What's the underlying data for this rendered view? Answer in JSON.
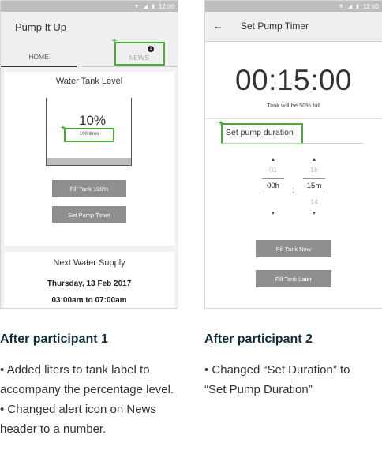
{
  "statusbar": {
    "time": "12:00",
    "wifi_icon": "wifi-icon",
    "signal_icon": "signal-icon",
    "battery_icon": "battery-icon"
  },
  "screen1": {
    "app_title": "Pump It Up",
    "tabs": [
      {
        "label": "HOME"
      },
      {
        "label": "NEWS"
      }
    ],
    "news_badge": "1",
    "tank_card": {
      "title": "Water Tank Level",
      "percent": "10%",
      "percent_value": 10,
      "litres": "100 litres",
      "buttons": [
        "Fill Tank 100%",
        "Set Pump Timer"
      ]
    },
    "supply_card": {
      "title": "Next Water Supply",
      "date": "Thursday, 13 Feb 2017",
      "time": "03:00am to 07:00am"
    }
  },
  "screen2": {
    "title": "Set Pump Timer",
    "timer": "00:15:00",
    "tank_note": "Tank will be 50% full",
    "duration_label": "Set pump duration",
    "picker_hours": {
      "above": "01",
      "value": "00h",
      "below": ""
    },
    "picker_minutes": {
      "above": "16",
      "value": "15m",
      "below": "14"
    },
    "colon": ":",
    "buttons": [
      "Fill Tank Now",
      "Fill Tank Later"
    ]
  },
  "captions": [
    {
      "title": "After participant 1",
      "lines": [
        "• Added liters to tank label to accompany the percentage level.",
        "• Changed alert icon on News header to a number."
      ]
    },
    {
      "title": "After participant 2",
      "lines": [
        "• Changed “Set Duration” to “Set Pump Duration”"
      ]
    }
  ],
  "colors": {
    "annotation_green": "#4aaa38",
    "button_gray": "#8f8f8f",
    "caption_title": "#0f2e3b"
  }
}
